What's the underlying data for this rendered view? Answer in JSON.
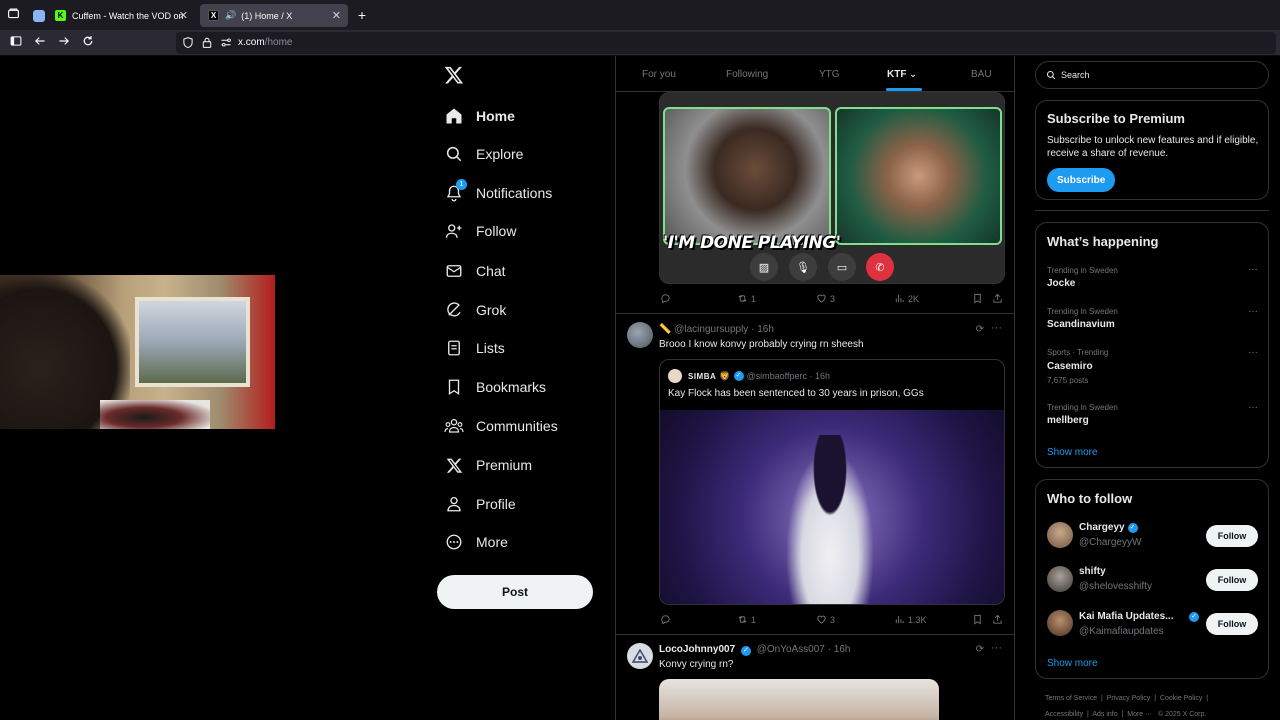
{
  "browser": {
    "tabs": [
      {
        "title": "Cuffem - Watch the VOD on Kic",
        "favicon": "K"
      },
      {
        "title": "(1) Home / X",
        "favicon": "X"
      }
    ],
    "new_tab": "+",
    "url_domain": "x.com",
    "url_path": "/home"
  },
  "sidebar": {
    "items": [
      {
        "label": "Home",
        "icon": "home-icon"
      },
      {
        "label": "Explore",
        "icon": "search-icon"
      },
      {
        "label": "Notifications",
        "icon": "bell-icon",
        "badge": "1"
      },
      {
        "label": "Follow",
        "icon": "person-add-icon"
      },
      {
        "label": "Chat",
        "icon": "envelope-icon"
      },
      {
        "label": "Grok",
        "icon": "grok-icon"
      },
      {
        "label": "Lists",
        "icon": "list-icon"
      },
      {
        "label": "Bookmarks",
        "icon": "bookmark-icon"
      },
      {
        "label": "Communities",
        "icon": "communities-icon"
      },
      {
        "label": "Premium",
        "icon": "x-logo-icon"
      },
      {
        "label": "Profile",
        "icon": "person-icon"
      },
      {
        "label": "More",
        "icon": "more-circle-icon"
      }
    ],
    "post_label": "Post"
  },
  "feed": {
    "tabs": [
      "For you",
      "Following",
      "YTG",
      "KTF",
      "BAU"
    ],
    "active_tab": "KTF",
    "post1": {
      "overlay_text": "'I'M DONE PLAYING'",
      "retweets": "1",
      "likes": "3",
      "views": "2K"
    },
    "post2": {
      "handle": "@lacingursupply",
      "time": "16h",
      "text": "Brooo I know konvy probably crying rn sheesh",
      "quote": {
        "name": "SIMBA",
        "handle": "@simbaoffperc",
        "time": "16h",
        "text": "Kay Flock has been sentenced to 30 years in prison, GGs"
      },
      "retweets": "1",
      "likes": "3",
      "views": "1.3K"
    },
    "post3": {
      "name": "LocoJohnny007",
      "handle": "@OnYoAss007",
      "time": "16h",
      "text": "Konvy crying rn?"
    }
  },
  "right": {
    "search_placeholder": "Search",
    "premium": {
      "title": "Subscribe to Premium",
      "text": "Subscribe to unlock new features and if eligible, receive a share of revenue.",
      "button": "Subscribe"
    },
    "happening": {
      "title": "What’s happening",
      "trends": [
        {
          "meta": "Trending in Sweden",
          "name": "Jocke",
          "posts": ""
        },
        {
          "meta": "Trending in Sweden",
          "name": "Scandinavium",
          "posts": ""
        },
        {
          "meta": "Sports · Trending",
          "name": "Casemiro",
          "posts": "7,675 posts"
        },
        {
          "meta": "Trending in Sweden",
          "name": "mellberg",
          "posts": ""
        }
      ],
      "show_more": "Show more"
    },
    "who_to_follow": {
      "title": "Who to follow",
      "users": [
        {
          "name": "Chargeyy",
          "handle": "@ChargeyyW",
          "verified": true
        },
        {
          "name": "shifty",
          "handle": "@shelovesshifty",
          "verified": false
        },
        {
          "name": "Kai Mafia Updates...",
          "handle": "@Kaimafiaupdates",
          "verified": true
        }
      ],
      "follow_label": "Follow",
      "show_more": "Show more"
    },
    "footer": {
      "line1": [
        "Terms of Service",
        "Privacy Policy",
        "Cookie Policy"
      ],
      "line2": [
        "Accessibility",
        "Ads info",
        "More ···",
        "© 2025 X Corp."
      ]
    }
  },
  "colors": {
    "accent": "#1d9bf0",
    "background": "#000000",
    "border": "#2f3336",
    "muted": "#71767b"
  }
}
